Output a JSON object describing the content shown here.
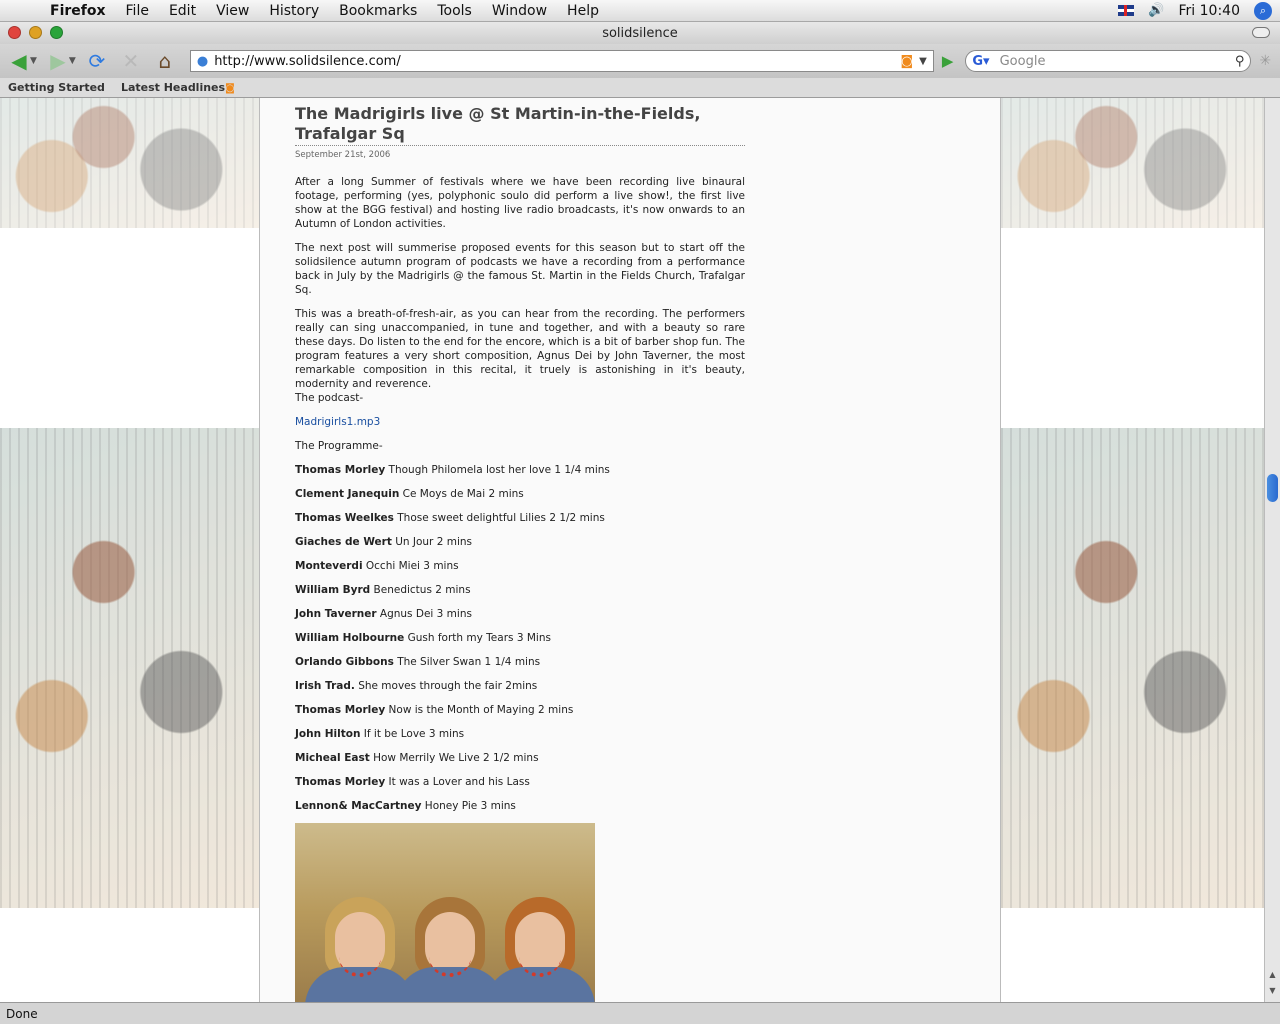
{
  "menubar": {
    "app": "Firefox",
    "items": [
      "File",
      "Edit",
      "View",
      "History",
      "Bookmarks",
      "Tools",
      "Window",
      "Help"
    ],
    "clock": "Fri 10:40"
  },
  "window": {
    "title": "solidsilence"
  },
  "navbar": {
    "url": "http://www.solidsilence.com/",
    "search_placeholder": "Google"
  },
  "bookmarks": [
    "Getting Started",
    "Latest Headlines"
  ],
  "post": {
    "title": "The Madrigirls live @ St Martin-in-the-Fields, Trafalgar Sq",
    "date": "September 21st, 2006",
    "paragraphs": [
      "After a long Summer of festivals where we have been recording live binaural footage, performing (yes, polyphonic soulo did perform a live show!, the first live show at the BGG festival) and hosting live radio broadcasts, it's now onwards to an Autumn of London activities.",
      "The next post will summerise proposed events for this season but to start off the solidsilence autumn program of podcasts we have a recording from a performance back in July by the Madrigirls @ the famous St. Martin in the Fields Church, Trafalgar Sq.",
      "This was a breath-of-fresh-air, as you can hear from the recording. The performers really can sing unaccompanied, in tune and together, and with a beauty so rare these days. Do listen to the end for the encore, which is a bit of barber shop fun. The program features a very short composition, Agnus Dei by John Taverner, the most remarkable composition in this recital, it truely is astonishing in it's beauty, modernity and reverence."
    ],
    "podcast_label": "The podcast-",
    "podcast_link": "Madrigirls1.mp3",
    "programme_heading": "The Programme-",
    "programme": [
      {
        "composer": "Thomas Morley",
        "piece": "Though Philomela lost her love 1 1/4 mins"
      },
      {
        "composer": "Clement Janequin",
        "piece": "Ce Moys de Mai 2 mins"
      },
      {
        "composer": "Thomas Weelkes",
        "piece": "Those sweet delightful Lilies 2 1/2 mins"
      },
      {
        "composer": "Giaches de Wert",
        "piece": "Un Jour 2 mins"
      },
      {
        "composer": "Monteverdi",
        "piece": "Occhi Miei 3 mins"
      },
      {
        "composer": "William Byrd",
        "piece": "Benedictus 2 mins"
      },
      {
        "composer": "John Taverner",
        "piece": "Agnus Dei 3 mins"
      },
      {
        "composer": "William Holbourne",
        "piece": "Gush forth my Tears 3 Mins"
      },
      {
        "composer": "Orlando Gibbons",
        "piece": "The Silver Swan 1 1/4 mins"
      },
      {
        "composer": "Irish Trad.",
        "piece": "She moves through the fair 2mins"
      },
      {
        "composer": "Thomas Morley",
        "piece": "Now is the Month of Maying 2 mins"
      },
      {
        "composer": "John Hilton",
        "piece": "If it be Love 3 mins"
      },
      {
        "composer": "Micheal East",
        "piece": "How Merrily We Live 2 1/2 mins"
      },
      {
        "composer": "Thomas Morley",
        "piece": "It was a Lover and his Lass"
      },
      {
        "composer": "Lennon& MacCartney",
        "piece": "Honey Pie 3 mins"
      }
    ]
  },
  "status": "Done",
  "icons": {
    "back": "back-arrow-icon",
    "forward": "forward-arrow-icon",
    "reload": "reload-icon",
    "stop": "stop-icon",
    "home": "home-icon",
    "rss": "rss-feed-icon",
    "go": "go-arrow-icon",
    "search": "magnifier-icon"
  },
  "colors": {
    "link": "#1a4fa0",
    "scroll_thumb": "#2a6ad0"
  }
}
